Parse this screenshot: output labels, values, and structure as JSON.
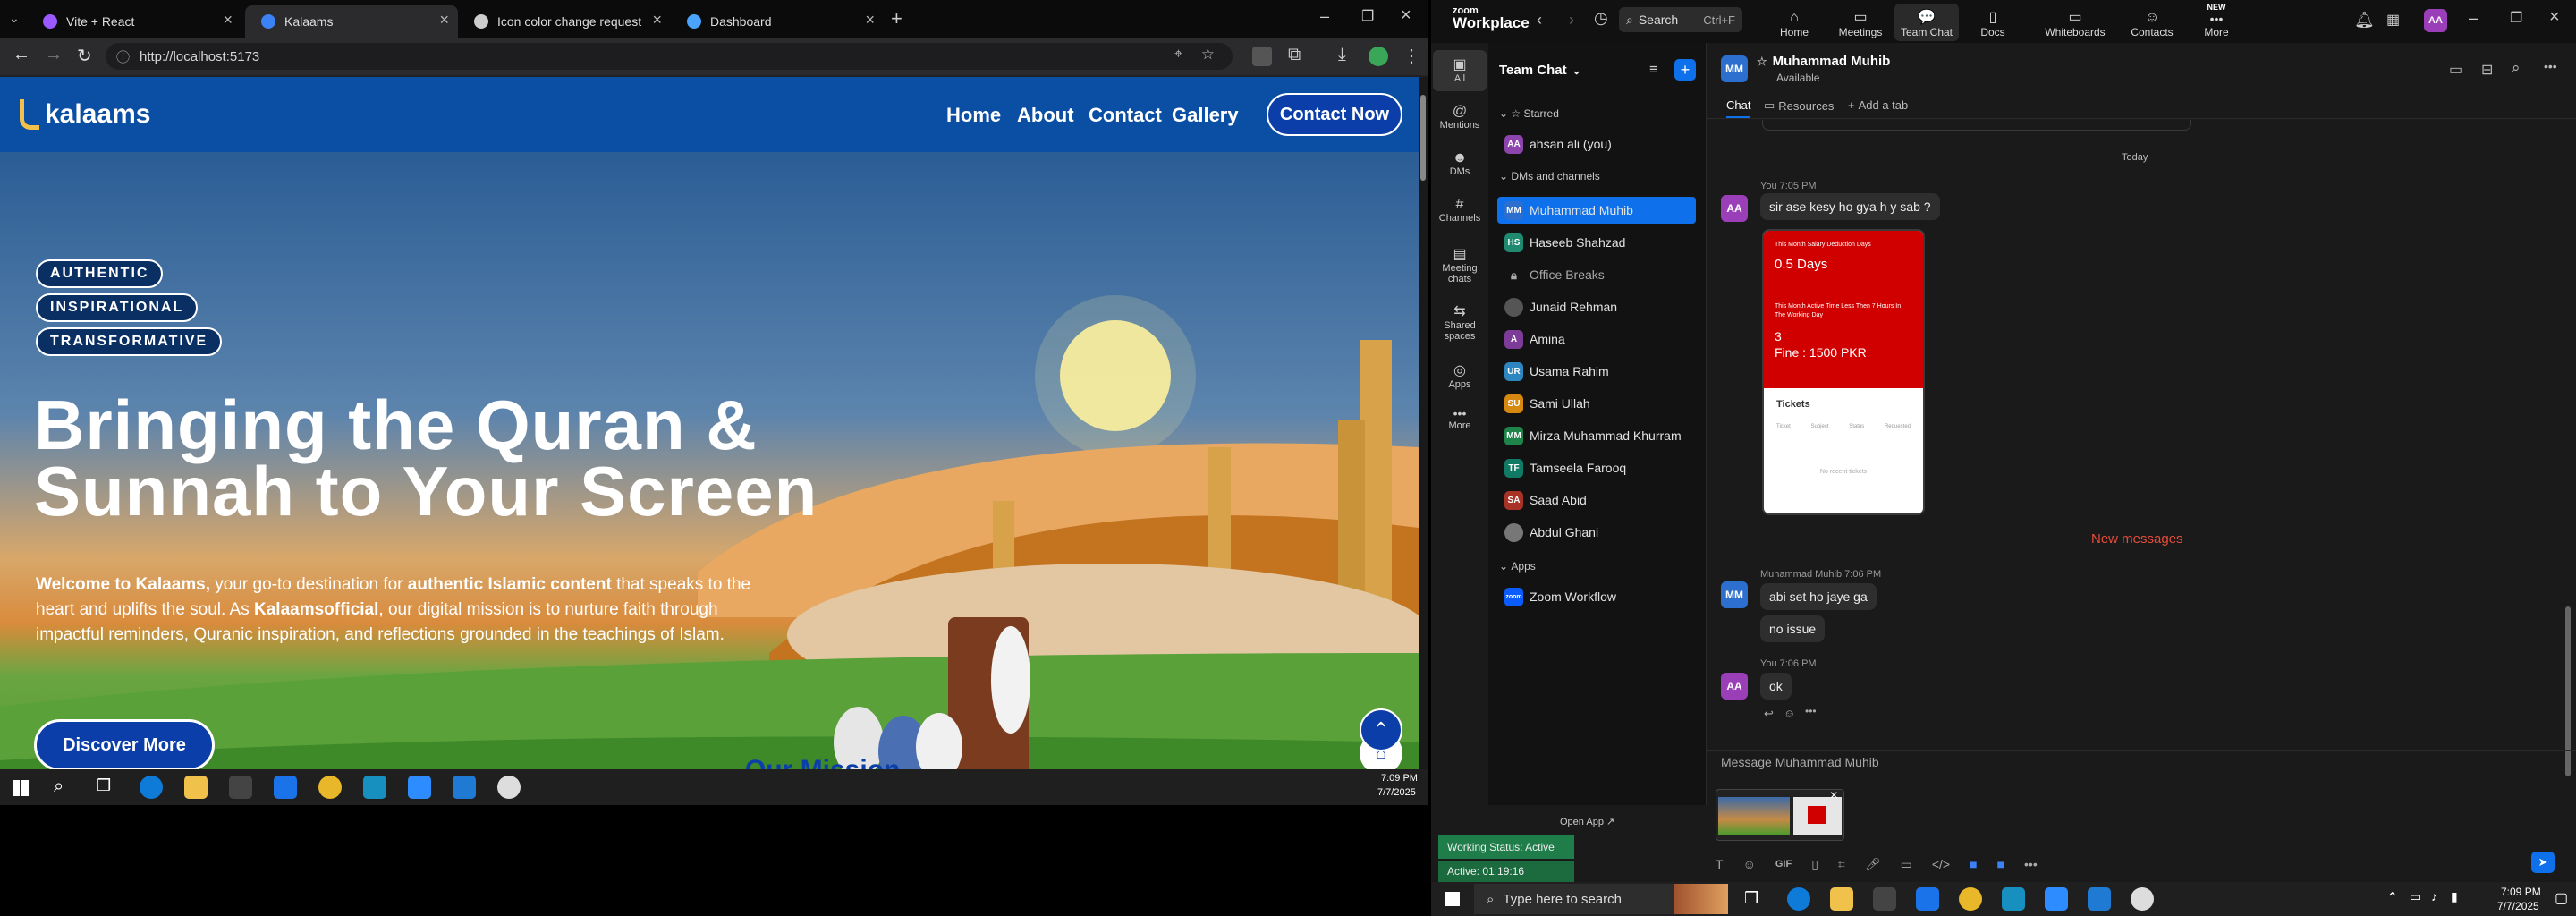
{
  "browser": {
    "tabs": [
      {
        "title": "Vite + React",
        "fav": "#9b59ff",
        "active": false
      },
      {
        "title": "Kalaams",
        "fav": "#3b82f6",
        "active": true
      },
      {
        "title": "Icon color change request",
        "fav": "#cccccc",
        "active": false
      },
      {
        "title": "Dashboard",
        "fav": "#4aa3ff",
        "active": false
      }
    ],
    "url": "http://localhost:5173"
  },
  "site": {
    "logo": "kalaams",
    "nav": [
      "Home",
      "About",
      "Contact",
      "Gallery"
    ],
    "contact_button": "Contact Now",
    "pills": [
      "AUTHENTIC",
      "INSPIRATIONAL",
      "TRANSFORMATIVE"
    ],
    "title_line1": "Bringing the Quran &",
    "title_line2": "Sunnah to Your Screen",
    "desc_1": "Welcome to Kalaams,",
    "desc_2": " your go-to destination for ",
    "desc_3": "authentic Islamic content",
    "desc_4": " that speaks to the heart and uplifts the soul. As ",
    "desc_5": "Kalaamsofficial",
    "desc_6": ", our digital mission is to nurture faith through impactful reminders, Quranic inspiration, and reflections grounded in the teachings of Islam.",
    "discover_button": "Discover More",
    "next_section_peek": "Our Mission"
  },
  "left_clock": {
    "time": "7:09 PM",
    "date": "7/7/2025"
  },
  "zoom": {
    "brand_top": "zoom",
    "brand_bottom": "Workplace",
    "search_label": "Search",
    "search_shortcut": "Ctrl+F",
    "top_nav": [
      {
        "label": "Home"
      },
      {
        "label": "Meetings"
      },
      {
        "label": "Team Chat"
      },
      {
        "label": "Docs"
      },
      {
        "label": "Whiteboards"
      },
      {
        "label": "Contacts"
      },
      {
        "label": "More"
      }
    ],
    "new_badge": "NEW",
    "user_initials": "AA",
    "rail": [
      "All",
      "Mentions",
      "DMs",
      "Channels",
      "Meeting chats",
      "Shared spaces",
      "Apps",
      "More"
    ],
    "team_chat_title": "Team Chat",
    "starred_label": "Starred",
    "starred": [
      {
        "name": "ahsan ali (you)",
        "initials": "AA",
        "color": "#8e44ad"
      }
    ],
    "dms_label": "DMs and channels",
    "dms": [
      {
        "name": "Muhammad Muhib",
        "initials": "MM",
        "color": "#2c6fcf"
      },
      {
        "name": "Haseeb Shahzad",
        "initials": "HS",
        "color": "#1f8a70"
      },
      {
        "name": "Office Breaks",
        "initials": "",
        "color": "#444444"
      },
      {
        "name": "Junaid Rehman",
        "initials": "",
        "color": "#555555"
      },
      {
        "name": "Amina",
        "initials": "A",
        "color": "#7d3c98"
      },
      {
        "name": "Usama Rahim",
        "initials": "UR",
        "color": "#2e86c1"
      },
      {
        "name": "Sami Ullah",
        "initials": "SU",
        "color": "#d68910"
      },
      {
        "name": "Mirza Muhammad Khurram",
        "initials": "MM",
        "color": "#1e8449"
      },
      {
        "name": "Tamseela Farooq",
        "initials": "TF",
        "color": "#117a65"
      },
      {
        "name": "Saad Abid",
        "initials": "SA",
        "color": "#a93226"
      },
      {
        "name": "Abdul Ghani",
        "initials": "",
        "color": "#666666"
      }
    ],
    "apps_label": "Apps",
    "apps": [
      {
        "name": "Zoom Workflow",
        "initials": "zoom",
        "color": "#0b5cff"
      }
    ],
    "open_app": "Open App",
    "working_status": "Working Status: Active",
    "active_time": "Active: 01:19:16",
    "chat": {
      "name": "Muhammad Muhib",
      "initials": "MM",
      "status": "Available",
      "tabs": [
        "Chat",
        "Resources",
        "Add a tab"
      ],
      "today": "Today",
      "msg1_meta": "You 7:05 PM",
      "msg1": "sir ase kesy ho gya h y sab ?",
      "card": {
        "l1": "This Month Salary Deduction Days",
        "l2": "0.5 Days",
        "l3": "This Month Active Time Less Then 7 Hours In The Working Day",
        "l4": "3",
        "l5": "Fine : 1500 PKR",
        "tickets": "Tickets",
        "cols": [
          "Ticket",
          "Subject",
          "Status",
          "Requested"
        ],
        "empty": "No recent tickets"
      },
      "new_messages": "New messages",
      "msg2_meta": "Muhammad Muhib 7:06 PM",
      "msg2a": "abi set ho jaye ga",
      "msg2b": "no issue",
      "msg3_meta": "You 7:06 PM",
      "msg3": "ok",
      "composer_placeholder": "Message Muhammad Muhib"
    }
  },
  "taskbar": {
    "search_placeholder": "Type here to search",
    "time": "7:09 PM",
    "date": "7/7/2025"
  }
}
